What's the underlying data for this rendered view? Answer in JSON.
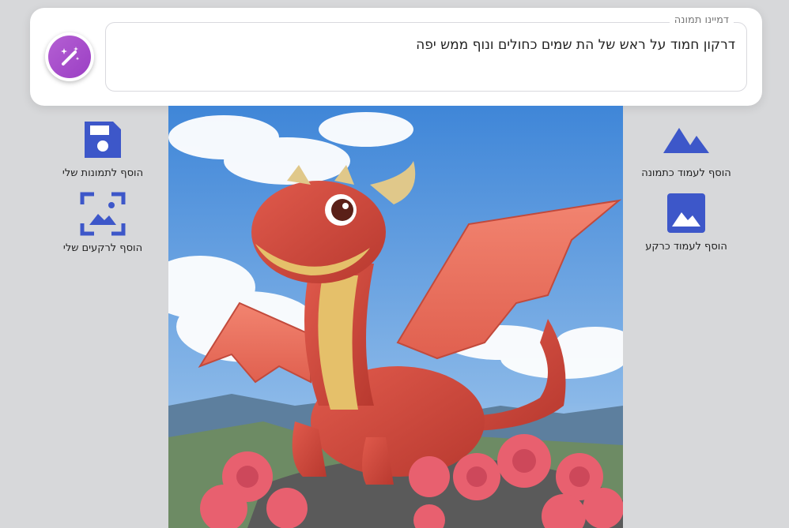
{
  "prompt": {
    "legend": "דמיינו תמונה",
    "text": "דרקון חמוד על ראש של הת שמים כחולים ונוף ממש יפה"
  },
  "left_actions": [
    {
      "label": "הוסף לתמונות שלי",
      "icon": "save-icon"
    },
    {
      "label": "הוסף לרקעים שלי",
      "icon": "wallpaper-icon"
    }
  ],
  "right_actions": [
    {
      "label": "הוסף לעמוד כתמונה",
      "icon": "mountains-icon"
    },
    {
      "label": "הוסף לעמוד כרקע",
      "icon": "landscape-icon"
    }
  ],
  "colors": {
    "accent_blue": "#3d57c9",
    "magic_purple": "#a24ccb",
    "background": "#d7d8da"
  }
}
